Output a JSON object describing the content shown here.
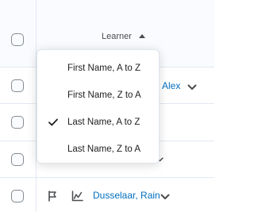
{
  "header": {
    "column_label": "Learner",
    "sort_direction": "ascending"
  },
  "sort_menu": {
    "items": [
      {
        "label": "First Name, A to Z",
        "selected": false
      },
      {
        "label": "First Name, Z to A",
        "selected": false
      },
      {
        "label": "Last Name, A to Z",
        "selected": true
      },
      {
        "label": "Last Name, Z to A",
        "selected": false
      }
    ]
  },
  "rows": [
    {
      "name_visible": "Alex"
    },
    {
      "name_visible": ""
    },
    {
      "name_visible": ""
    },
    {
      "name_visible": "Dusselaar, Rain"
    }
  ],
  "colors": {
    "link": "#006fbf",
    "border": "#e3e9f1",
    "header_bg": "#f9fbff"
  },
  "icons": {
    "flag": "flag-icon",
    "chart": "line-chart-icon",
    "chevron": "chevron-down-icon",
    "check": "checkmark-icon"
  }
}
